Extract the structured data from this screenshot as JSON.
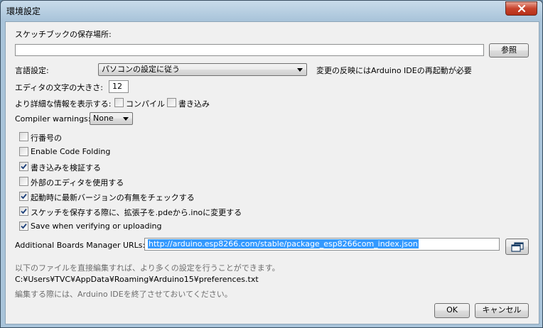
{
  "window": {
    "title": "環境設定"
  },
  "sketchbook": {
    "label": "スケッチブックの保存場所:",
    "value": "",
    "browse_button": "参照"
  },
  "language": {
    "label": "言語設定:",
    "selected": "パソコンの設定に従う",
    "restart_note": "変更の反映にはArduino IDEの再起動が必要"
  },
  "font_size": {
    "label": "エディタの文字の大きさ:",
    "value": "12"
  },
  "verbose": {
    "label": "より詳細な情報を表示する:",
    "compile_label": "コンパイル",
    "compile_checked": false,
    "upload_label": "書き込み",
    "upload_checked": false
  },
  "compiler_warnings": {
    "label": "Compiler warnings:",
    "selected": "None"
  },
  "options": [
    {
      "label": "行番号の",
      "checked": false
    },
    {
      "label": "Enable Code Folding",
      "checked": false
    },
    {
      "label": "書き込みを検証する",
      "checked": true
    },
    {
      "label": "外部のエディタを使用する",
      "checked": false
    },
    {
      "label": "起動時に最新バージョンの有無をチェックする",
      "checked": true
    },
    {
      "label": "スケッチを保存する際に、拡張子を.pdeから.inoに変更する",
      "checked": true
    },
    {
      "label": "Save when verifying or uploading",
      "checked": true
    }
  ],
  "boards_manager": {
    "label": "Additional Boards Manager URLs:",
    "value": "http://arduino.esp8266.com/stable/package_esp8266com_index.json"
  },
  "footer": {
    "edit_hint": "以下のファイルを直接編集すれば、より多くの設定を行うことができます。",
    "prefs_path": "C:¥Users¥TVC¥AppData¥Roaming¥Arduino15¥preferences.txt",
    "close_hint": "編集する際には、Arduino IDEを終了させておいてください。"
  },
  "buttons": {
    "ok": "OK",
    "cancel": "キャンセル"
  }
}
